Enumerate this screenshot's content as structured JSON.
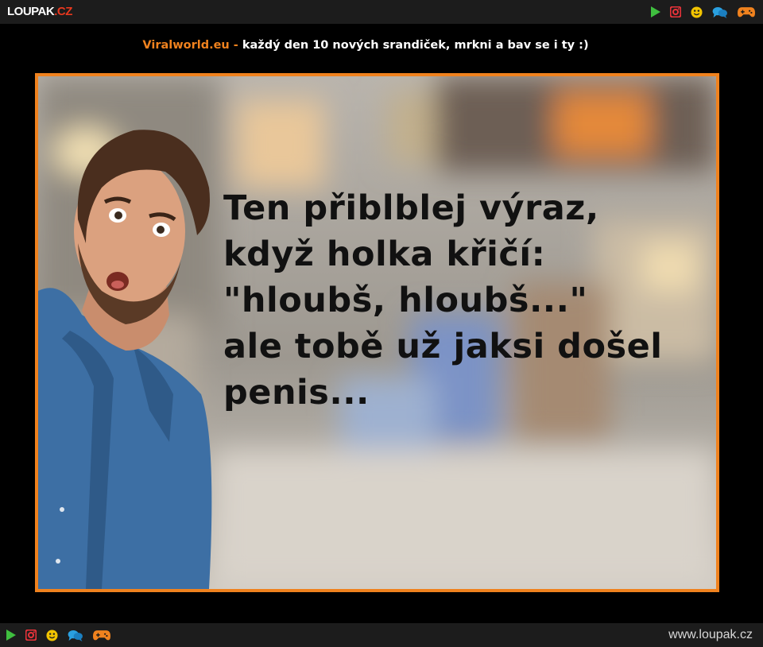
{
  "topbar": {
    "logo_text": "LOUPAK",
    "logo_suffix": ".CZ",
    "icons": [
      "play-icon",
      "instagram-icon",
      "smiley-icon",
      "chat-icon",
      "gamepad-icon"
    ]
  },
  "banner": {
    "site": "Viralworld.eu -",
    "text": " každý den 10 nových srandiček, mrkni a bav se i ty :)"
  },
  "meme": {
    "caption": "Ten přiblblej výraz,\nkdyž holka křičí:\n\"hloubš, hloubš...\"\nale tobě už jaksi došel\npenis..."
  },
  "footer": {
    "url": "www.loupak.cz",
    "icons": [
      "play-icon",
      "instagram-icon",
      "smiley-icon",
      "chat-icon",
      "gamepad-icon"
    ]
  },
  "colors": {
    "accent": "#f0821e",
    "bar": "#1c1c1c",
    "play": "#3fbf3f",
    "instagram": "#e8333a",
    "smiley": "#f2c400",
    "chat": "#2aa0e0",
    "gamepad": "#f0821e"
  }
}
